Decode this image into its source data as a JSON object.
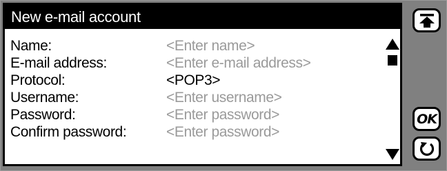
{
  "dialog": {
    "title": "New e-mail account",
    "fields": [
      {
        "label": "Name:",
        "value": "<Enter name>",
        "is_set": false
      },
      {
        "label": "E-mail address:",
        "value": "<Enter e-mail address>",
        "is_set": false
      },
      {
        "label": "Protocol:",
        "value": "<POP3>",
        "is_set": true
      },
      {
        "label": "Username:",
        "value": "<Enter username>",
        "is_set": false
      },
      {
        "label": "Password:",
        "value": "<Enter password>",
        "is_set": false
      },
      {
        "label": "Confirm password:",
        "value": "<Enter password>",
        "is_set": false
      }
    ]
  },
  "side_buttons": {
    "top": {
      "icon": "scroll-to-top-icon"
    },
    "ok": {
      "label": "OK"
    },
    "back": {
      "icon": "back-arrow-icon"
    }
  },
  "colors": {
    "placeholder": "#9a9a9a",
    "text": "#000000",
    "side_panel": "#808080"
  }
}
